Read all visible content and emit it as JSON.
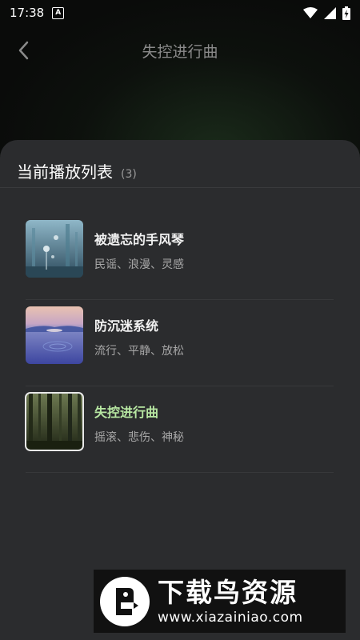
{
  "status_bar": {
    "time": "17:38",
    "notification_icon": "a-icon",
    "icons": [
      "wifi-icon",
      "signal-icon",
      "battery-charging-icon"
    ]
  },
  "header": {
    "back_icon": "chevron-left-icon",
    "title": "失控进行曲"
  },
  "playlist": {
    "title": "当前播放列表",
    "count": "(3)",
    "tracks": [
      {
        "name": "被遗忘的手风琴",
        "tags": "民谣、浪漫、灵感",
        "active": false
      },
      {
        "name": "防沉迷系统",
        "tags": "流行、平静、放松",
        "active": false
      },
      {
        "name": "失控进行曲",
        "tags": "摇滚、悲伤、神秘",
        "active": true
      }
    ]
  },
  "colors": {
    "active_track": "#b7e7a2",
    "sheet_bg": "#2b2c2e"
  },
  "watermark": {
    "title": "下载鸟资源",
    "url": "www.xiazainiao.com"
  }
}
